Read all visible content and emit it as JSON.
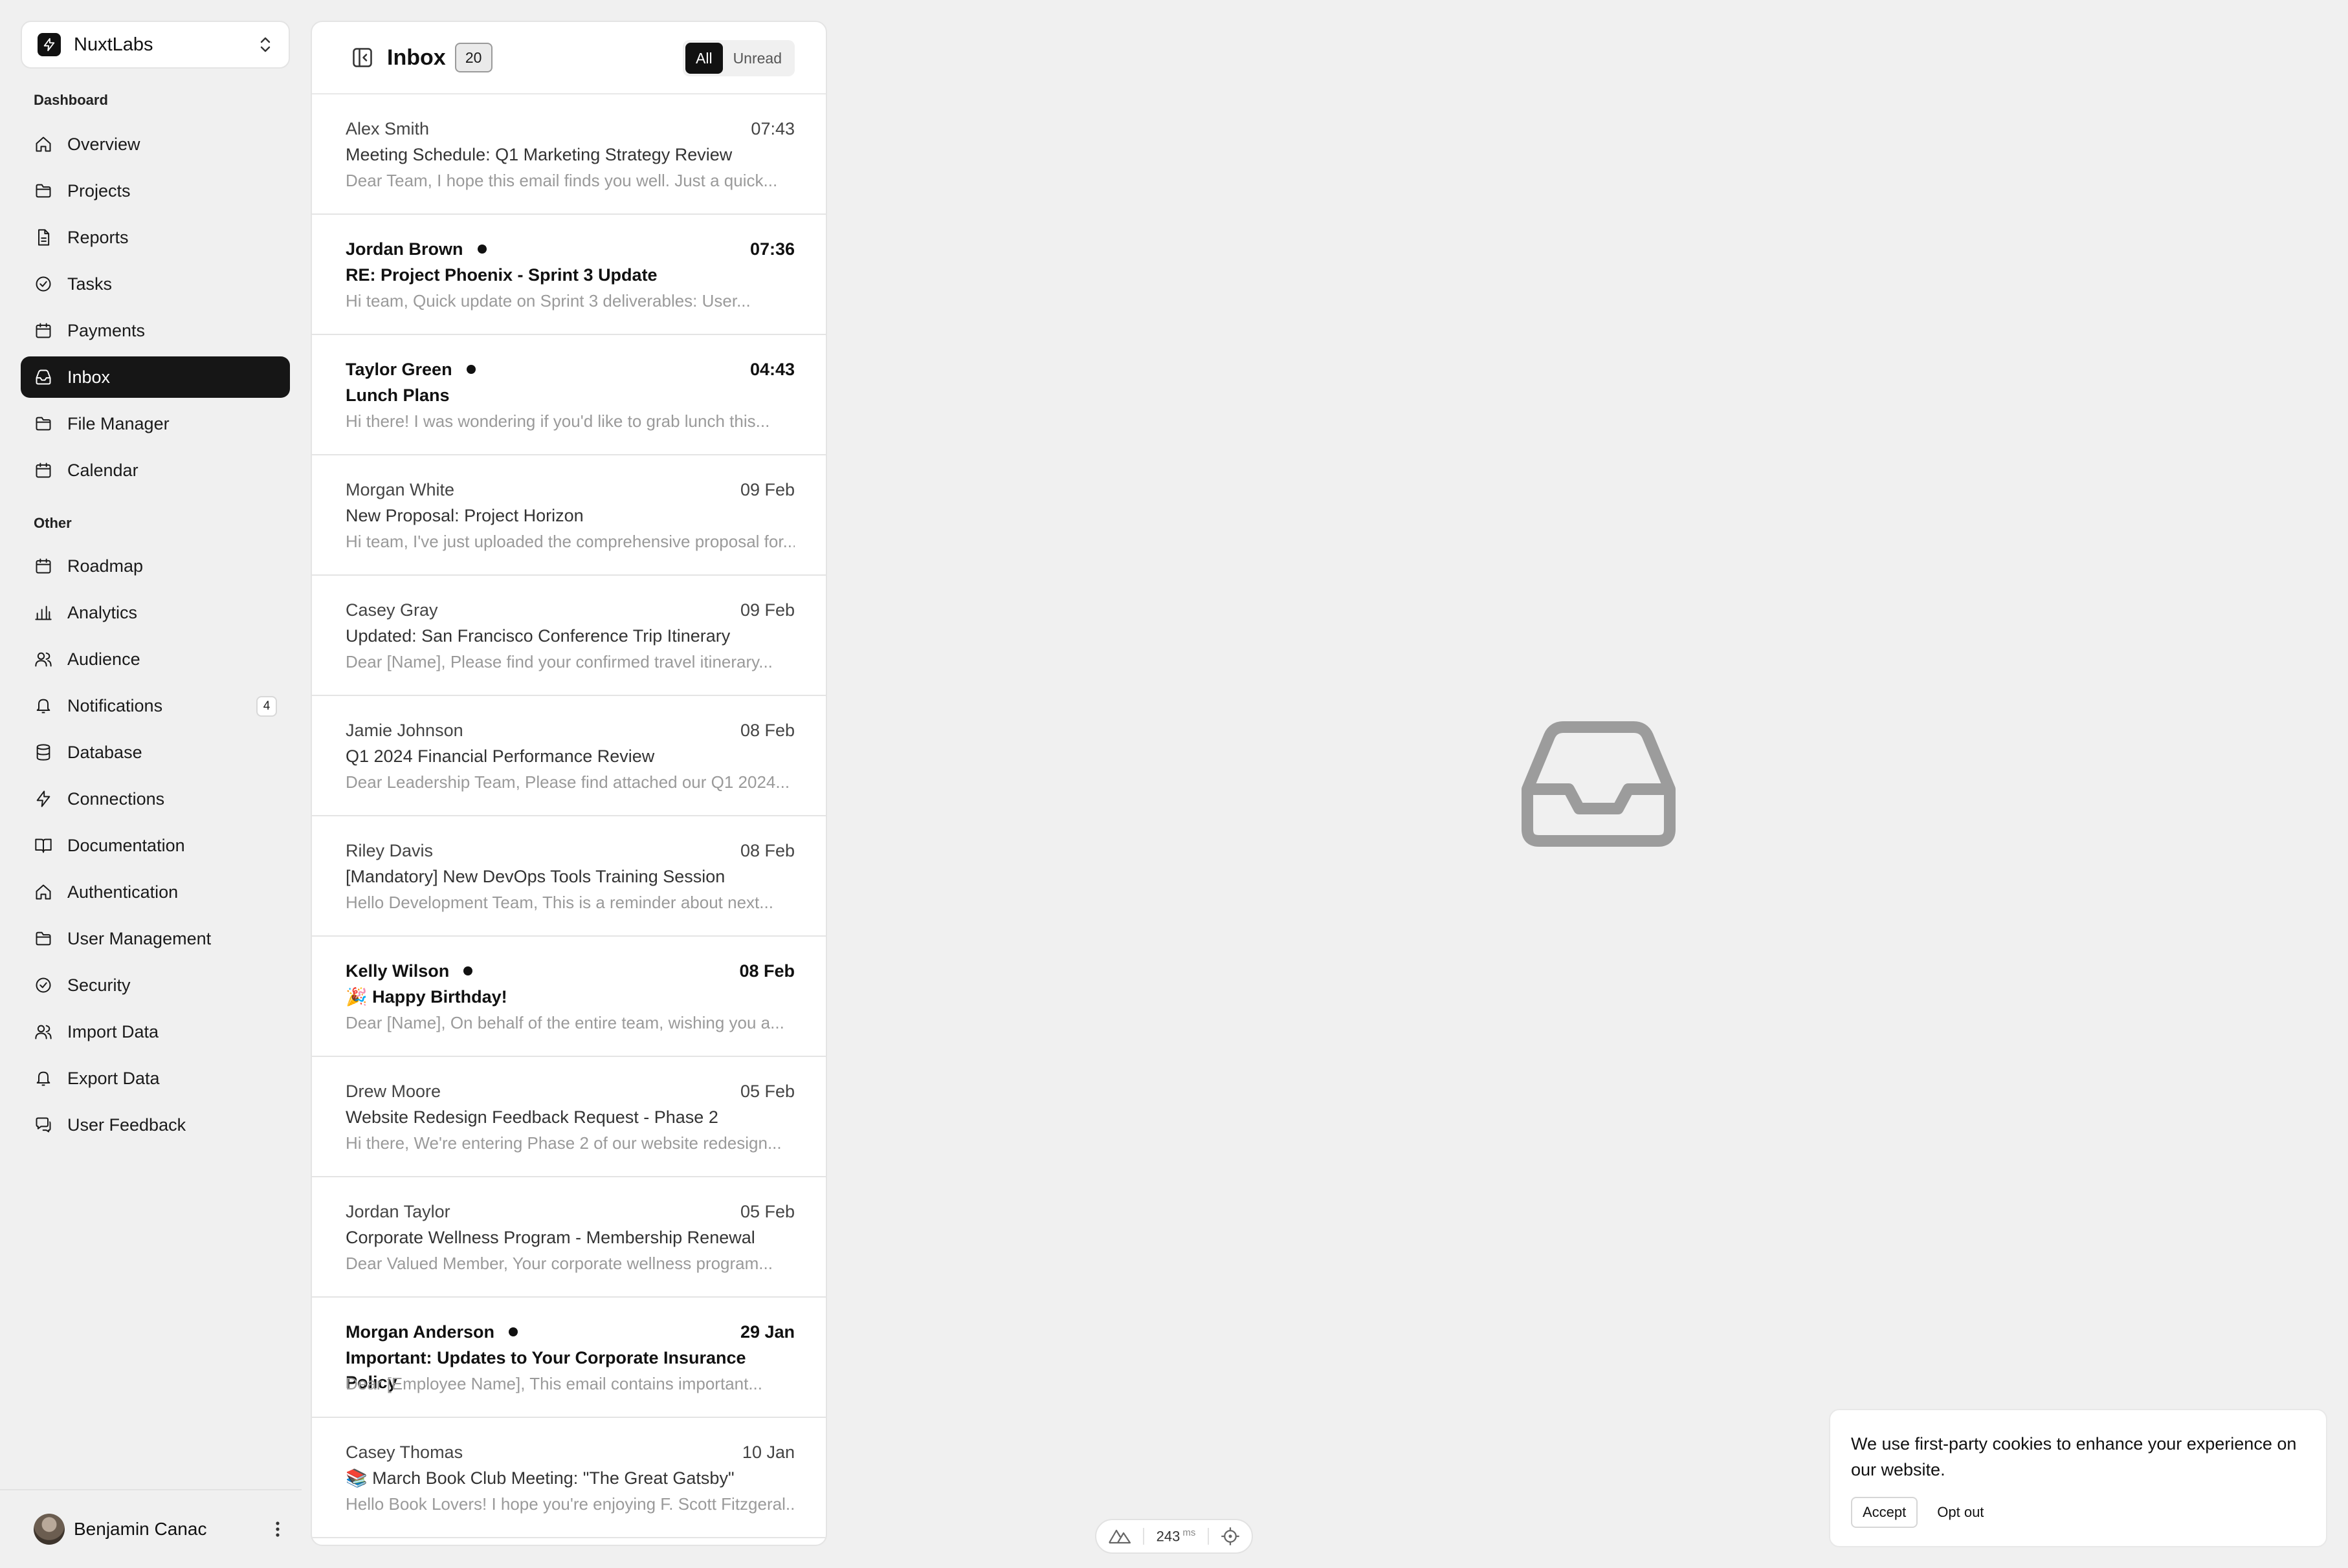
{
  "team": {
    "name": "NuxtLabs"
  },
  "sidebar": {
    "dashboard_label": "Dashboard",
    "dashboard_items": [
      {
        "label": "Overview",
        "icon": "home-icon"
      },
      {
        "label": "Projects",
        "icon": "folder-icon"
      },
      {
        "label": "Reports",
        "icon": "file-icon"
      },
      {
        "label": "Tasks",
        "icon": "check-circle-icon"
      },
      {
        "label": "Payments",
        "icon": "calendar-icon"
      },
      {
        "label": "Inbox",
        "icon": "inbox-icon",
        "active": true
      },
      {
        "label": "File Manager",
        "icon": "folder-icon"
      },
      {
        "label": "Calendar",
        "icon": "calendar-icon"
      }
    ],
    "other_label": "Other",
    "other_items": [
      {
        "label": "Roadmap",
        "icon": "calendar-icon"
      },
      {
        "label": "Analytics",
        "icon": "bar-chart-icon"
      },
      {
        "label": "Audience",
        "icon": "users-icon"
      },
      {
        "label": "Notifications",
        "icon": "bell-icon",
        "badge": "4"
      },
      {
        "label": "Database",
        "icon": "database-icon"
      },
      {
        "label": "Connections",
        "icon": "bolt-icon"
      },
      {
        "label": "Documentation",
        "icon": "book-icon"
      },
      {
        "label": "Authentication",
        "icon": "home-icon"
      },
      {
        "label": "User Management",
        "icon": "folder-icon"
      },
      {
        "label": "Security",
        "icon": "check-circle-icon"
      },
      {
        "label": "Import Data",
        "icon": "users-icon"
      },
      {
        "label": "Export Data",
        "icon": "bell-icon"
      },
      {
        "label": "User Feedback",
        "icon": "chat-icon"
      }
    ]
  },
  "user": {
    "name": "Benjamin Canac"
  },
  "inbox": {
    "title": "Inbox",
    "count": "20",
    "filters": {
      "all": "All",
      "unread": "Unread"
    },
    "mails": [
      {
        "from": "Alex Smith",
        "time": "07:43",
        "subject": "Meeting Schedule: Q1 Marketing Strategy Review",
        "preview": "Dear Team, I hope this email finds you well. Just a quick...",
        "unread": false
      },
      {
        "from": "Jordan Brown",
        "time": "07:36",
        "subject": "RE: Project Phoenix - Sprint 3 Update",
        "preview": "Hi team, Quick update on Sprint 3 deliverables: User...",
        "unread": true
      },
      {
        "from": "Taylor Green",
        "time": "04:43",
        "subject": "Lunch Plans",
        "preview": "Hi there! I was wondering if you'd like to grab lunch this...",
        "unread": true
      },
      {
        "from": "Morgan White",
        "time": "09 Feb",
        "subject": "New Proposal: Project Horizon",
        "preview": "Hi team, I've just uploaded the comprehensive proposal for...",
        "unread": false
      },
      {
        "from": "Casey Gray",
        "time": "09 Feb",
        "subject": "Updated: San Francisco Conference Trip Itinerary",
        "preview": "Dear [Name], Please find your confirmed travel itinerary...",
        "unread": false
      },
      {
        "from": "Jamie Johnson",
        "time": "08 Feb",
        "subject": "Q1 2024 Financial Performance Review",
        "preview": "Dear Leadership Team, Please find attached our Q1 2024...",
        "unread": false
      },
      {
        "from": "Riley Davis",
        "time": "08 Feb",
        "subject": "[Mandatory] New DevOps Tools Training Session",
        "preview": "Hello Development Team, This is a reminder about next...",
        "unread": false
      },
      {
        "from": "Kelly Wilson",
        "time": "08 Feb",
        "subject": "🎉 Happy Birthday!",
        "preview": "Dear [Name], On behalf of the entire team, wishing you a...",
        "unread": true
      },
      {
        "from": "Drew Moore",
        "time": "05 Feb",
        "subject": "Website Redesign Feedback Request - Phase 2",
        "preview": "Hi there, We're entering Phase 2 of our website redesign...",
        "unread": false
      },
      {
        "from": "Jordan Taylor",
        "time": "05 Feb",
        "subject": "Corporate Wellness Program - Membership Renewal",
        "preview": "Dear Valued Member, Your corporate wellness program...",
        "unread": false
      },
      {
        "from": "Morgan Anderson",
        "time": "29 Jan",
        "subject": "Important: Updates to Your Corporate Insurance Policy",
        "preview": "Dear [Employee Name], This email contains important...",
        "unread": true
      },
      {
        "from": "Casey Thomas",
        "time": "10 Jan",
        "subject": "📚 March Book Club Meeting: \"The Great Gatsby\"",
        "preview": "Hello Book Lovers! I hope you're enjoying F. Scott Fitzgeral...",
        "unread": false
      }
    ]
  },
  "empty_state": {
    "icon": "inbox-icon"
  },
  "devtools": {
    "value": "243",
    "unit": "ms"
  },
  "cookie": {
    "text": "We use first-party cookies to enhance your experience on our website.",
    "accept": "Accept",
    "optout": "Opt out"
  }
}
